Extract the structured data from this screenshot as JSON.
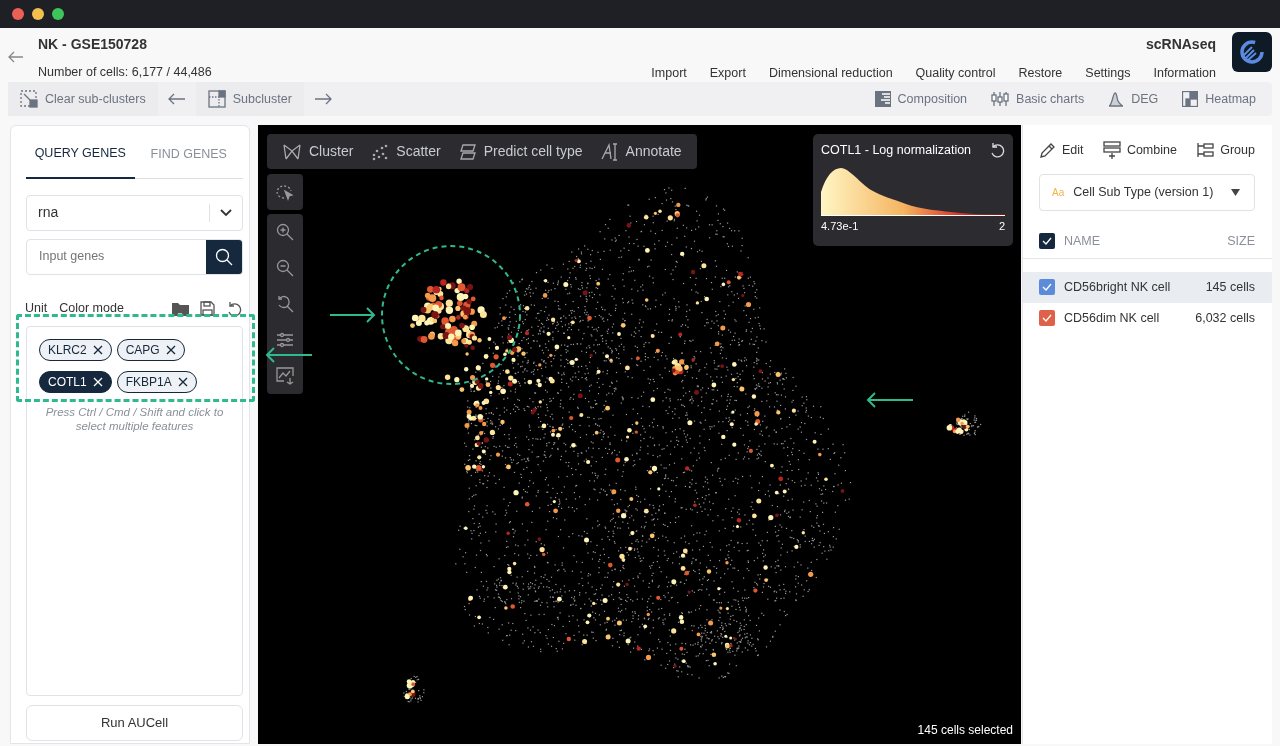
{
  "window": {
    "controls": [
      {
        "color": "#ec5f57"
      },
      {
        "color": "#f4bf4f"
      },
      {
        "color": "#3ec55a"
      }
    ]
  },
  "header": {
    "title": "NK - GSE150728",
    "cell_count": "Number of cells: 6,177 / 44,486",
    "app_name": "scRNAseq",
    "menu": [
      "Import",
      "Export",
      "Dimensional reduction",
      "Quality control",
      "Restore",
      "Settings",
      "Information"
    ]
  },
  "toolbar": {
    "left": [
      "Clear sub-clusters",
      "Subcluster"
    ],
    "right": [
      "Composition",
      "Basic charts",
      "DEG",
      "Heatmap"
    ]
  },
  "left_panel": {
    "tabs": [
      {
        "label": "QUERY GENES",
        "selected": true
      },
      {
        "label": "FIND GENES",
        "selected": false
      }
    ],
    "assay_select": {
      "value": "rna"
    },
    "gene_search": {
      "placeholder": "Input genes"
    },
    "options": [
      "Unit",
      "Color mode"
    ],
    "genes": [
      {
        "label": "KLRC2",
        "selected": false
      },
      {
        "label": "CAPG",
        "selected": false
      },
      {
        "label": "COTL1",
        "selected": true
      },
      {
        "label": "FKBP1A",
        "selected": false
      }
    ],
    "hint": "Press Ctrl / Cmd / Shift and click to select multiple features",
    "run_button": "Run AUCell"
  },
  "plot": {
    "tools": [
      "Cluster",
      "Scatter",
      "Predict cell type",
      "Annotate"
    ],
    "legend": {
      "title": "COTL1 - Log normalization",
      "min": "4.73e-1",
      "max": "2"
    },
    "status": "145 cells selected"
  },
  "right_panel": {
    "actions": [
      "Edit",
      "Combine",
      "Group"
    ],
    "metadata_select": {
      "type_label": "Aa",
      "value": "Cell Sub Type (version 1)"
    },
    "header": {
      "checked": true,
      "name": "NAME",
      "size": "SIZE"
    },
    "groups": [
      {
        "name": "CD56bright NK cell",
        "size": "145 cells",
        "color": "#5b8bd9",
        "checked": true,
        "selected": true
      },
      {
        "name": "CD56dim NK cell",
        "size": "6,032 cells",
        "color": "#e0614a",
        "checked": true,
        "selected": false
      }
    ]
  }
}
